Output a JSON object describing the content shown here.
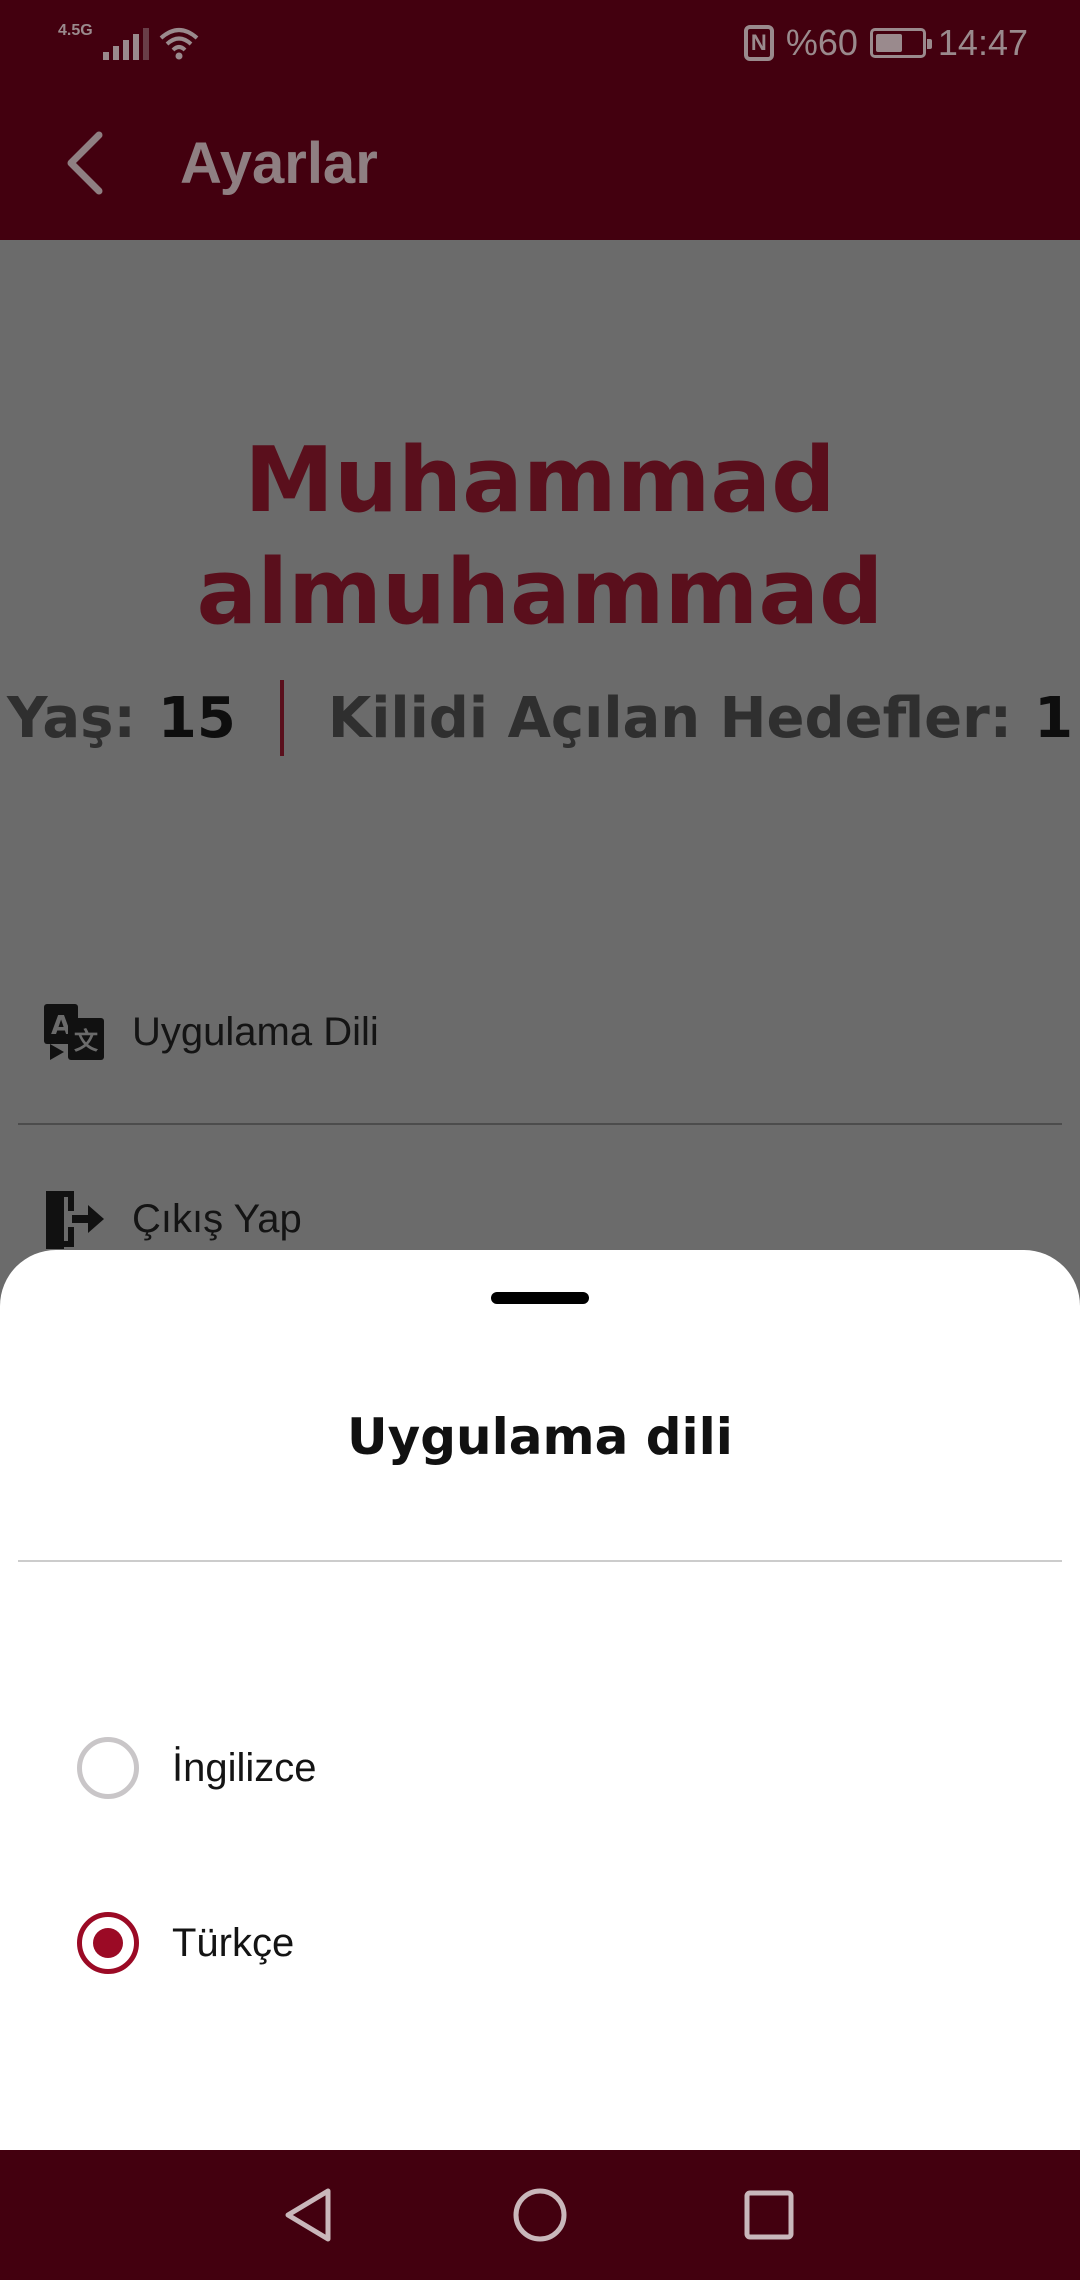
{
  "status_bar": {
    "network_type": "4.5G",
    "battery_percent": "%60",
    "battery_level": 0.6,
    "time": "14:47"
  },
  "app_bar": {
    "title": "Ayarlar"
  },
  "profile": {
    "name_line1": "Muhammad",
    "name_line2": "almuhammad",
    "age_label": "Yaş:",
    "age_value": "15",
    "goals_label": "Kilidi Açılan Hedefler:",
    "goals_value": "1"
  },
  "menu": {
    "items": [
      {
        "label": "Uygulama Dili",
        "icon": "translate-icon"
      },
      {
        "label": "Çıkış Yap",
        "icon": "logout-icon"
      }
    ]
  },
  "language_sheet": {
    "title": "Uygulama dili",
    "options": [
      {
        "label": "İngilizce",
        "selected": false
      },
      {
        "label": "Türkçe",
        "selected": true
      }
    ]
  },
  "colors": {
    "brand": "#43000f",
    "accent": "#9b0a25",
    "scrim": "#6b6b6b"
  }
}
